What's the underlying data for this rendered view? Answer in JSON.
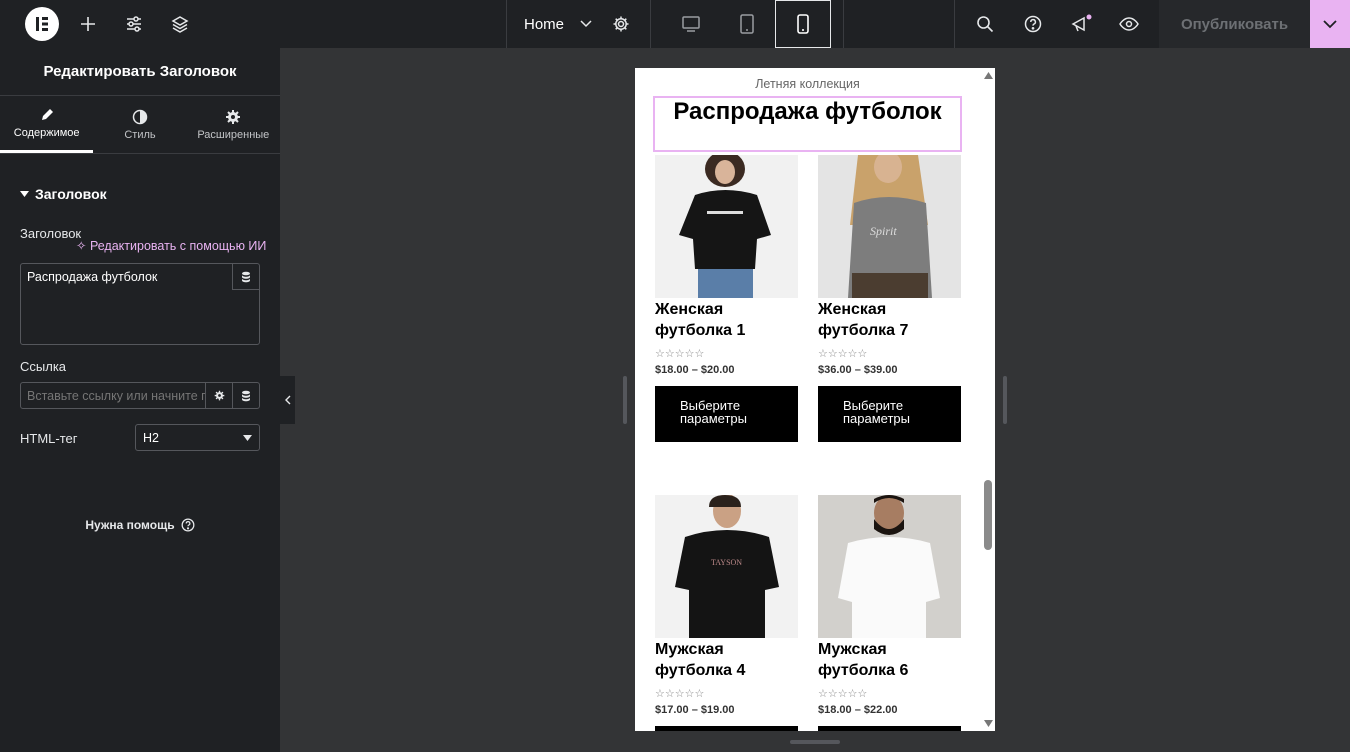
{
  "topbar": {
    "page_name": "Home",
    "publish_label": "Опубликовать"
  },
  "panel": {
    "title": "Редактировать Заголовок",
    "tabs": [
      {
        "label": "Содержимое",
        "icon": "pencil-icon"
      },
      {
        "label": "Стиль",
        "icon": "contrast-icon"
      },
      {
        "label": "Расширенные",
        "icon": "gear-icon"
      }
    ],
    "section_title": "Заголовок",
    "title_label": "Заголовок",
    "ai_link": "Редактировать с помощью ИИ",
    "title_value": "Распродажа футболок",
    "link_label": "Ссылка",
    "link_placeholder": "Вставьте ссылку или начните п",
    "html_tag_label": "HTML-тег",
    "html_tag_value": "H2",
    "help_label": "Нужна помощь"
  },
  "preview": {
    "subtitle": "Летняя коллекция",
    "heading": "Распродажа футболок",
    "products": [
      {
        "name_line1": "Женская",
        "name_line2": "футболка 1",
        "stars": "☆☆☆☆☆",
        "price": "$18.00 – $20.00",
        "button_line1": "Выберите",
        "button_line2": "параметры"
      },
      {
        "name_line1": "Женская",
        "name_line2": "футболка 7",
        "stars": "☆☆☆☆☆",
        "price": "$36.00 – $39.00",
        "button_line1": "Выберите",
        "button_line2": "параметры"
      },
      {
        "name_line1": "Мужская",
        "name_line2": "футболка 4",
        "stars": "☆☆☆☆☆",
        "price": "$17.00 – $19.00",
        "button_line1": "",
        "button_line2": ""
      },
      {
        "name_line1": "Мужская",
        "name_line2": "футболка 6",
        "stars": "☆☆☆☆☆",
        "price": "$18.00 – $22.00",
        "button_line1": "",
        "button_line2": ""
      }
    ]
  },
  "colors": {
    "accent": "#e9b3f2",
    "panel_bg": "#1f2124",
    "canvas_bg": "#333436"
  }
}
